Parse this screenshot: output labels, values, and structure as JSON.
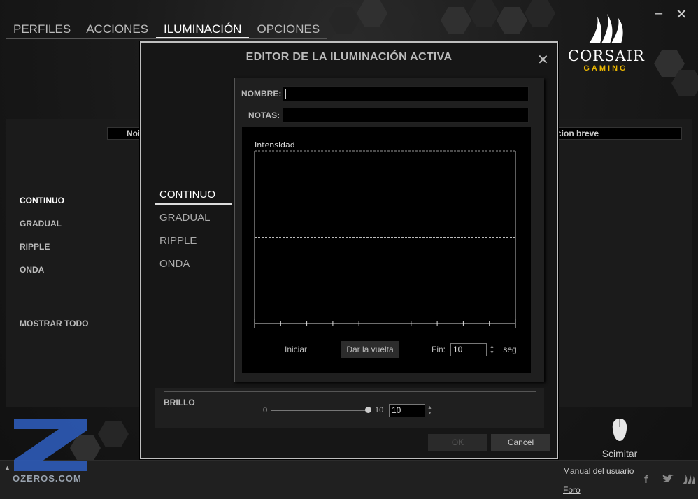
{
  "nav": {
    "items": [
      "PERFILES",
      "ACCIONES",
      "ILUMINACIÓN",
      "OPCIONES"
    ],
    "active_index": 2
  },
  "window": {
    "minimize": "–",
    "close": "✕"
  },
  "logo": {
    "brand": "CORSAIR",
    "sub": "GAMING"
  },
  "background": {
    "menu": [
      "CONTINUO",
      "GRADUAL",
      "RIPPLE",
      "ONDA"
    ],
    "show_all": "MOSTRAR TODO",
    "col_name": "Noi",
    "col_desc": "cion breve"
  },
  "footer": {
    "manual": "Manual del usuario",
    "forum": "Foro",
    "device": "Scimitar"
  },
  "watermark": {
    "text": "OZEROS.COM"
  },
  "modal": {
    "title": "EDITOR DE LA ILUMINACIÓN ACTIVA",
    "close": "✕",
    "menu": [
      "CONTINUO",
      "GRADUAL",
      "RIPPLE",
      "ONDA"
    ],
    "active_index": 0,
    "name_label": "NOMBRE:",
    "name_value": "",
    "notes_label": "NOTAS:",
    "notes_value": "",
    "graph": {
      "label": "Intensidad",
      "tick_count": 11,
      "level": 0.5
    },
    "start_label": "Iniciar",
    "loop_label": "Dar la vuelta",
    "end_label": "Fin:",
    "end_value": "10",
    "unit": "seg",
    "brightness": {
      "label": "BRILLO",
      "min": "0",
      "max": "10",
      "value": "10",
      "fraction": 1.0
    },
    "ok": "OK",
    "cancel": "Cancel"
  },
  "colors": {
    "accent": "#e8b400",
    "border": "#bfbfbf"
  }
}
